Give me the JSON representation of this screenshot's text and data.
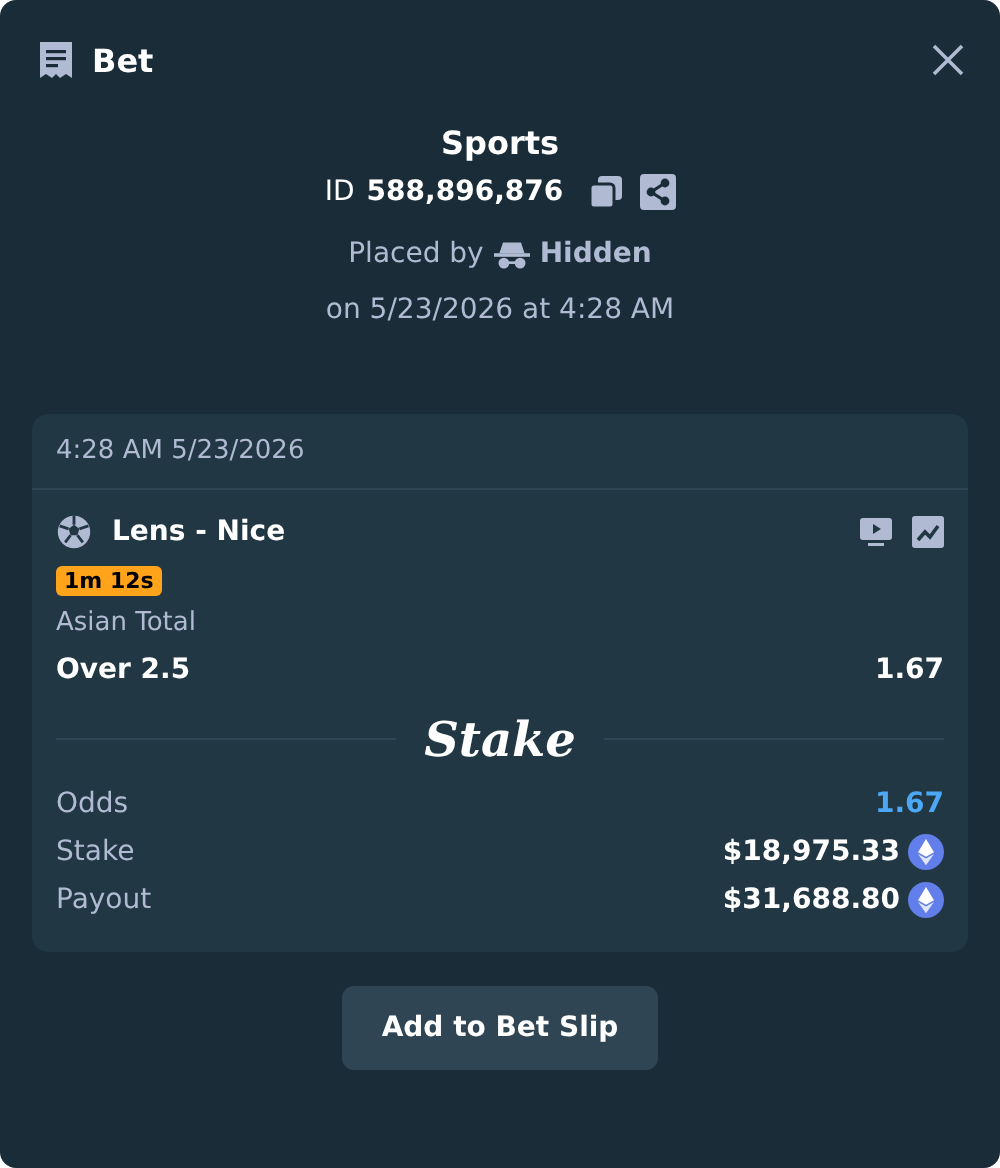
{
  "modal": {
    "title": "Bet"
  },
  "summary": {
    "category": "Sports",
    "id_label": "ID",
    "id_value": "588,896,876",
    "placed_by_label": "Placed by",
    "user": "Hidden",
    "placed_on": "on 5/23/2026 at 4:28 AM"
  },
  "bet_card": {
    "timestamp": "4:28 AM 5/23/2026",
    "event": "Lens - Nice",
    "timer_badge": "1m 12s",
    "market": "Asian Total",
    "outcome": "Over 2.5",
    "outcome_odds": "1.67",
    "brand": "Stake",
    "stats": [
      {
        "label": "Odds",
        "value": "1.67",
        "kind": "odds"
      },
      {
        "label": "Stake",
        "value": "$18,975.33",
        "kind": "currency"
      },
      {
        "label": "Payout",
        "value": "$31,688.80",
        "kind": "currency"
      }
    ]
  },
  "actions": {
    "button": "Add to Bet Slip"
  }
}
